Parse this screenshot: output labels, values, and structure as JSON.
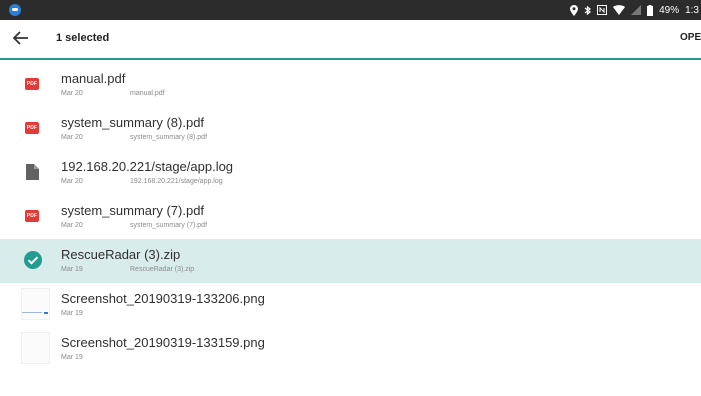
{
  "status_bar": {
    "app_icon": "app-launcher-icon",
    "battery": "49%",
    "time": "1:3",
    "icons": [
      "location-icon",
      "bluetooth-icon",
      "nfc-icon",
      "wifi-icon",
      "signal-icon",
      "battery-icon"
    ]
  },
  "toolbar": {
    "back_icon": "arrow-back-icon",
    "title": "1 selected",
    "action": "OPEN",
    "accent": "#239b8e"
  },
  "files": [
    {
      "name": "manual.pdf",
      "date": "Mar 20",
      "path": "manual.pdf",
      "icon": "pdf-icon"
    },
    {
      "name": "system_summary (8).pdf",
      "date": "Mar 20",
      "path": "system_summary (8).pdf",
      "icon": "pdf-icon"
    },
    {
      "name": "192.168.20.221/stage/app.log",
      "date": "Mar 20",
      "path": "192.168.20.221/stage/app.log",
      "icon": "document-icon"
    },
    {
      "name": "system_summary (7).pdf",
      "date": "Mar 20",
      "path": "system_summary (7).pdf",
      "icon": "pdf-icon"
    },
    {
      "name": "RescueRadar (3).zip",
      "date": "Mar 19",
      "path": "RescueRadar (3).zip",
      "icon": "check-circle-icon",
      "selected": true
    },
    {
      "name": "Screenshot_20190319-133206.png",
      "date": "Mar 19",
      "icon": "image-thumbnail"
    },
    {
      "name": "Screenshot_20190319-133159.png",
      "date": "Mar 19",
      "icon": "image-thumbnail"
    }
  ],
  "pdf_badge_text": "PDF",
  "colors": {
    "pdf": "#e53935",
    "selected_bg": "#d9ecec",
    "check": "#239b8e"
  }
}
